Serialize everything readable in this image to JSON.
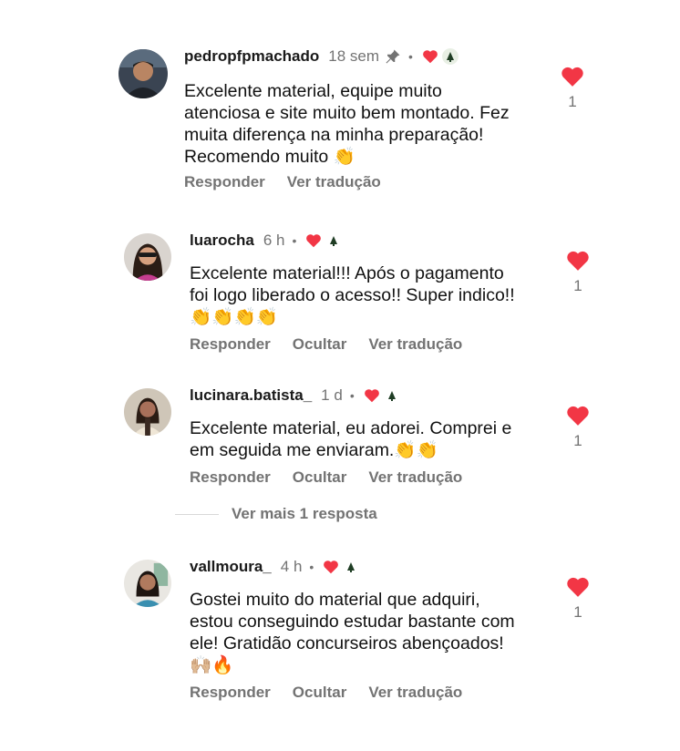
{
  "colors": {
    "like_red": "#f23645",
    "meta_gray": "#737373"
  },
  "comments": [
    {
      "username": "pedropfpmachado",
      "time": "18 sem",
      "text": "Excelente material, equipe muito\natenciosa e site muito bem montado. Fez\nmuita diferença na minha preparação!\nRecomendo muito 👏",
      "actions": [
        "Responder",
        "Ver tradução"
      ],
      "likes": "1"
    },
    {
      "username": "luarocha",
      "time": "6 h",
      "text": "Excelente material!!! Após o pagamento\nfoi logo liberado o acesso!! Super indico!!\n👏👏👏👏",
      "actions": [
        "Responder",
        "Ocultar",
        "Ver tradução"
      ],
      "likes": "1"
    },
    {
      "username": "lucinara.batista_",
      "time": "1 d",
      "text": "Excelente material, eu adorei. Comprei e\nem seguida me enviaram.👏👏",
      "actions": [
        "Responder",
        "Ocultar",
        "Ver tradução"
      ],
      "likes": "1"
    },
    {
      "username": "vallmoura_",
      "time": "4 h",
      "text": "Gostei muito do material que adquiri,\nestou conseguindo estudar bastante com\nele! Gratidão concurseiros abençoados!\n🙌🏼🔥",
      "actions": [
        "Responder",
        "Ocultar",
        "Ver tradução"
      ],
      "likes": "1"
    }
  ],
  "more_replies": "Ver mais 1 resposta",
  "icons": [
    "pin-icon",
    "heart-icon",
    "liked-by-author-avatar"
  ]
}
